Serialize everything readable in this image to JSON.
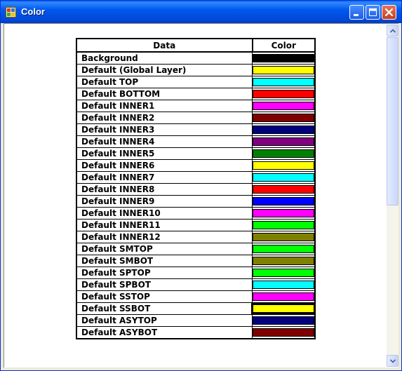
{
  "window": {
    "title": "Color",
    "title_bar_color": "#0054e3"
  },
  "table": {
    "headers": {
      "data": "Data",
      "color": "Color"
    },
    "rows": [
      {
        "label": "Background",
        "color": "#000000"
      },
      {
        "label": "Default (Global Layer)",
        "color": "#ffff00"
      },
      {
        "label": "Default TOP",
        "color": "#00ffff"
      },
      {
        "label": "Default BOTTOM",
        "color": "#ff0000"
      },
      {
        "label": "Default INNER1",
        "color": "#ff00ff"
      },
      {
        "label": "Default INNER2",
        "color": "#800000"
      },
      {
        "label": "Default INNER3",
        "color": "#000080"
      },
      {
        "label": "Default INNER4",
        "color": "#800080"
      },
      {
        "label": "Default INNER5",
        "color": "#008000"
      },
      {
        "label": "Default INNER6",
        "color": "#ffff00"
      },
      {
        "label": "Default INNER7",
        "color": "#00ffff"
      },
      {
        "label": "Default INNER8",
        "color": "#ff0000"
      },
      {
        "label": "Default INNER9",
        "color": "#0000ff"
      },
      {
        "label": "Default INNER10",
        "color": "#ff00ff"
      },
      {
        "label": "Default INNER11",
        "color": "#00ff00"
      },
      {
        "label": "Default INNER12",
        "color": "#808000"
      },
      {
        "label": "Default SMTOP",
        "color": "#00ff00"
      },
      {
        "label": "Default SMBOT",
        "color": "#808000"
      },
      {
        "label": "Default SPTOP",
        "color": "#00ff00"
      },
      {
        "label": "Default SPBOT",
        "color": "#00ffff"
      },
      {
        "label": "Default SSTOP",
        "color": "#ff00ff"
      },
      {
        "label": "Default SSBOT",
        "color": "#ffff00",
        "selected": true
      },
      {
        "label": "Default ASYTOP",
        "color": "#000080"
      },
      {
        "label": "Default ASYBOT",
        "color": "#800000"
      }
    ]
  }
}
